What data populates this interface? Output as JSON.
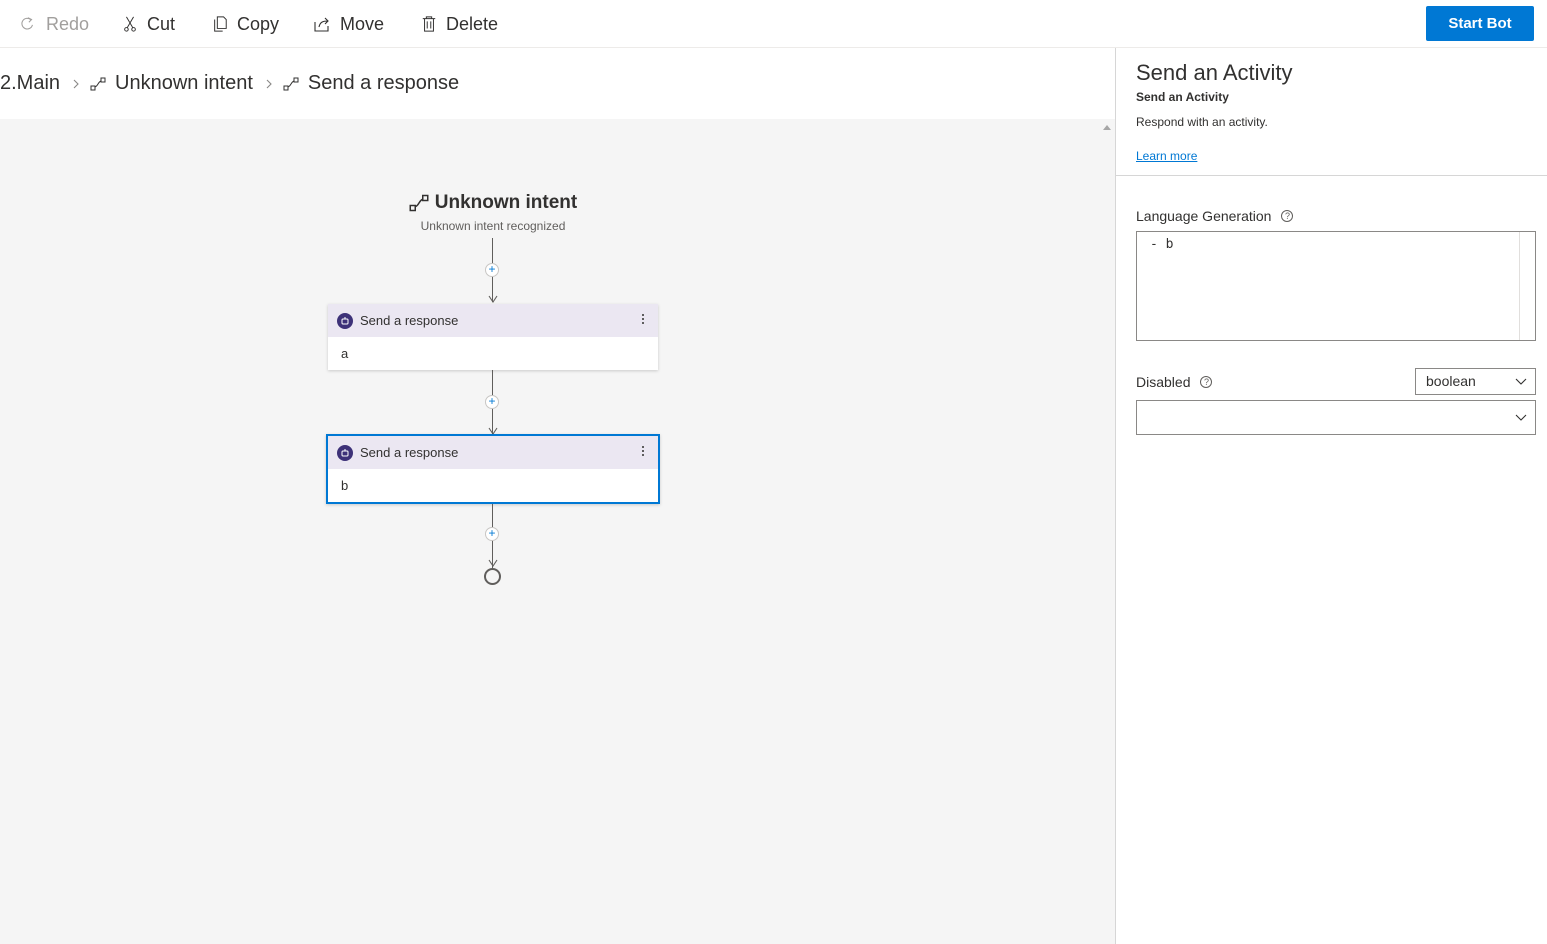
{
  "toolbar": {
    "redo": "Redo",
    "cut": "Cut",
    "copy": "Copy",
    "move": "Move",
    "delete": "Delete",
    "start_bot": "Start Bot"
  },
  "breadcrumb": {
    "items": [
      "2.Main",
      "Unknown intent",
      "Send a response"
    ]
  },
  "canvas": {
    "trigger": {
      "title": "Unknown intent",
      "subtitle": "Unknown intent recognized"
    },
    "nodes": [
      {
        "title": "Send a response",
        "body": "a",
        "selected": false
      },
      {
        "title": "Send a response",
        "body": "b",
        "selected": true
      }
    ]
  },
  "panel": {
    "title": "Send an Activity",
    "subtitle": "Send an Activity",
    "description": "Respond with an activity.",
    "learn_more": "Learn more",
    "lg_label": "Language Generation",
    "lg_value": "- b",
    "disabled_label": "Disabled",
    "disabled_type": "boolean",
    "disabled_value": ""
  },
  "colors": {
    "accent": "#0078d4",
    "node_header": "#ebe7f2",
    "node_icon": "#3d3178",
    "canvas_bg": "#f5f5f5"
  },
  "icons": {
    "redo": "redo-icon",
    "cut": "scissors-icon",
    "copy": "copy-icon",
    "move": "share-icon",
    "delete": "trash-icon",
    "trigger": "flow-icon",
    "node": "bot-icon"
  }
}
